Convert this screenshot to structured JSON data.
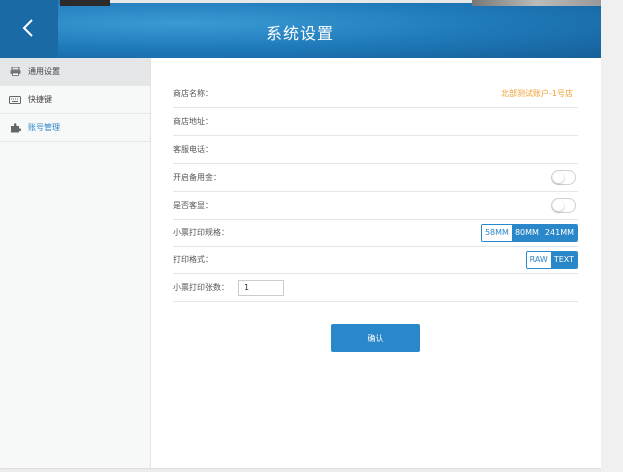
{
  "header": {
    "title": "系统设置",
    "back_icon": "chevron-left-icon"
  },
  "sidebar": {
    "items": [
      {
        "label": "通用设置",
        "icon": "printer-icon"
      },
      {
        "label": "快捷键",
        "icon": "keyboard-icon"
      },
      {
        "label": "账号管理",
        "icon": "puzzle-icon"
      }
    ]
  },
  "form": {
    "shop_name_label": "商店名称：",
    "shop_name_value": "北部测试账户-1号店",
    "shop_address_label": "商店地址：",
    "service_phone_label": "客服电话：",
    "petty_cash_label": "开启备用金：",
    "customer_display_label": "是否客显：",
    "receipt_size_label": "小票打印规格：",
    "receipt_size_options": [
      "58MM",
      "80MM",
      "241MM"
    ],
    "receipt_size_selected": "58MM",
    "print_format_label": "打印格式：",
    "print_format_options": [
      "RAW",
      "TEXT"
    ],
    "print_format_selected": "RAW",
    "copies_label": "小票打印张数：",
    "copies_value": "1",
    "confirm_label": "确认"
  },
  "colors": {
    "primary": "#2a87c9",
    "header": "#1e78b8",
    "highlight": "#f0a030"
  }
}
